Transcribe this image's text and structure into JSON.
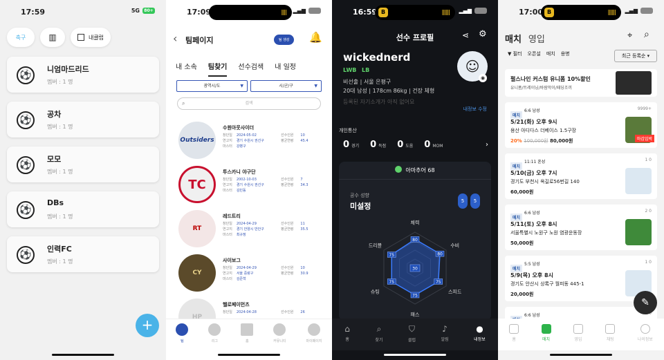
{
  "p1": {
    "time": "17:59",
    "signal": "5G",
    "battery": "80+",
    "chips": [
      "축구",
      "내클럽"
    ],
    "clubs": [
      {
        "name": "니엄마드리드",
        "members": "멤버 : 1 명"
      },
      {
        "name": "공차",
        "members": "멤버 : 1 명"
      },
      {
        "name": "모모",
        "members": "멤버 : 1 명"
      },
      {
        "name": "DBs",
        "members": "멤버 : 1 명"
      },
      {
        "name": "인력FC",
        "members": "멤버 : 1 명"
      }
    ],
    "fab": "+"
  },
  "p2": {
    "time": "17:09",
    "title": "팀페이지",
    "badge": "팀 생성",
    "tabs": [
      "내 소속",
      "팀찾기",
      "선수검색",
      "내 일정"
    ],
    "select_city": "광역시/도",
    "select_district": "시/군/구",
    "search_placeholder": "검색",
    "teams": [
      {
        "name": "수원아웃사이더",
        "logo": "Outsiders",
        "founded": "2024-05-02",
        "region": "경기 수원시 권선구",
        "master": "강병구",
        "players": "10",
        "avg_age": "45.4"
      },
      {
        "name": "투스카니 야구단",
        "logo": "TC",
        "founded": "2002-10-03",
        "region": "경기 수원시 권선구",
        "master": "김민동",
        "players": "7",
        "avg_age": "34.3"
      },
      {
        "name": "레드트리",
        "logo": "RT",
        "founded": "2024-04-29",
        "region": "경기 안양시 만안구",
        "master": "최규정",
        "players": "11",
        "avg_age": "35.5"
      },
      {
        "name": "사이보그",
        "logo": "CY",
        "founded": "2024-04-29",
        "region": "서울 중랑구",
        "master": "김준혁",
        "players": "10",
        "avg_age": "30.9"
      },
      {
        "name": "헬로페이먼츠",
        "logo": "HP",
        "founded": "2024-04-28",
        "region": "",
        "master": "",
        "players": "26",
        "avg_age": ""
      }
    ],
    "labels": {
      "founded": "창단일",
      "region": "연고지",
      "master": "마스터",
      "players": "선수인원",
      "avg": "평균연령"
    },
    "nav": [
      "팀",
      "리그",
      "홈",
      "커뮤니티",
      "마이페이지"
    ]
  },
  "p3": {
    "time": "16:59",
    "title": "선수 프로필",
    "name": "wickednerd",
    "positions": [
      "LWB",
      "LB"
    ],
    "line1": "비선출 | 서울 은평구",
    "line2": "20대 남성 | 178cm 86kg | 건장 체형",
    "intro": "등록된 자기소개가 아직 없어요",
    "edit": "내정보 수정",
    "stats_title": "개인통산",
    "stats": [
      {
        "v": "0",
        "l": "경기"
      },
      {
        "v": "0",
        "l": "득점"
      },
      {
        "v": "0",
        "l": "도움"
      },
      {
        "v": "0",
        "l": "MOM"
      }
    ],
    "manner": "아마추어 68",
    "tend_label": "공수 성향",
    "tend_value": "미설정",
    "foot_left": "5",
    "foot_right": "5",
    "radar": {
      "axes": [
        "체력",
        "수비",
        "스피드",
        "패스",
        "슈팅",
        "드리블"
      ],
      "values": [
        80,
        80,
        75,
        75,
        75,
        75
      ],
      "center": "30"
    },
    "nav": [
      "홈",
      "찾기",
      "클럽",
      "알림",
      "내정보"
    ]
  },
  "p4": {
    "time": "17:00",
    "tabs": [
      "매치",
      "영입"
    ],
    "filters": [
      "필터",
      "오픈설",
      "매치",
      "용병"
    ],
    "sort": "최근 등록순",
    "ad_title": "펄스나인 커스텀 유니폼 10%할인",
    "ad_sub": "유니폼/트레이닝/바람막이/패딩조끼",
    "matches": [
      {
        "tag": "매치",
        "sub": "6:6 남성",
        "count": "9999+",
        "title": "5/21(화) 오후 9시",
        "addr": "용산 아디다스 더베이스 1.5구장",
        "sale": "20%",
        "orig": "100,000원",
        "price": "80,000원",
        "thumb": "#5a7a3a",
        "status": "마감임박"
      },
      {
        "tag": "매치",
        "sub": "11:11 혼성",
        "count": "1  0",
        "title": "5/10(금) 오후 7시",
        "addr": "경기도 부천시 옥길로56번길 140",
        "sale": "",
        "orig": "",
        "price": "60,000원",
        "thumb": "#dce8f2",
        "status": ""
      },
      {
        "tag": "매치",
        "sub": "6:6 남성",
        "count": "2  0",
        "title": "5/11(토) 오후 8시",
        "addr": "서울특별시 노원구 노원 염광운동장",
        "sale": "",
        "orig": "",
        "price": "50,000원",
        "thumb": "#3f8a3a",
        "status": ""
      },
      {
        "tag": "매치",
        "sub": "5:5 남성",
        "count": "1  0",
        "title": "5/9(목) 오후 8시",
        "addr": "경기도 안산시 상록구 월피동 445-1",
        "sale": "",
        "orig": "",
        "price": "20,000원",
        "thumb": "#dce8f2",
        "status": ""
      },
      {
        "tag": "매치",
        "sub": "6:6 남성",
        "count": "1  0",
        "title": "",
        "addr": "",
        "sale": "",
        "orig": "",
        "price": "",
        "thumb": "#dce8f2",
        "status": ""
      }
    ],
    "nav": [
      "홈",
      "매치",
      "영입",
      "채팅",
      "나의정보"
    ]
  }
}
